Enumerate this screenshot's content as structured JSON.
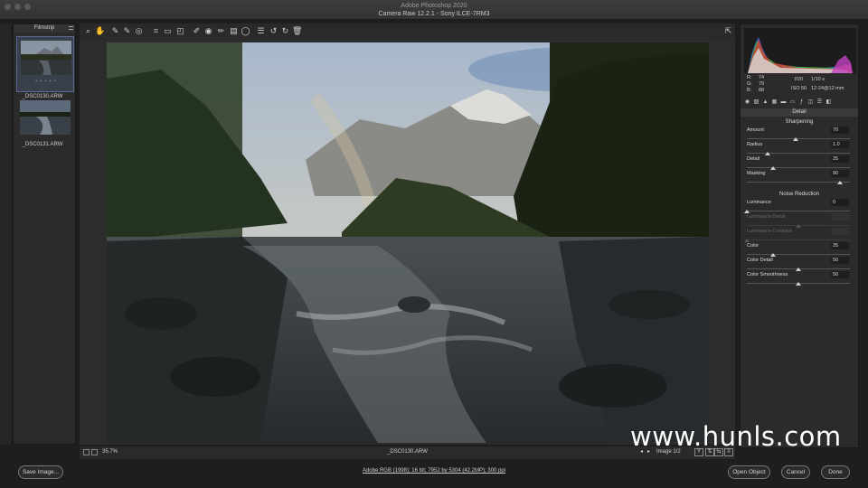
{
  "window": {
    "app_title": "Adobe Photoshop 2020",
    "subtitle": "Camera Raw 12.2.1  -  Sony ILCE-7RM3"
  },
  "filmstrip": {
    "title": "Filmstrip",
    "items": [
      {
        "label": "_DSC0130.ARW",
        "stars": "• • • • •",
        "selected": true
      },
      {
        "label": "_DSC0131.ARW",
        "stars": "",
        "selected": false
      }
    ]
  },
  "toolbar": {
    "tools": [
      "zoom-icon",
      "hand-icon",
      "white-balance-icon",
      "color-sampler-icon",
      "targeted-adjustment-icon",
      "crop-icon",
      "straighten-icon",
      "transform-icon",
      "spot-removal-icon",
      "red-eye-icon",
      "adjustment-brush-icon",
      "graduated-filter-icon",
      "radial-filter-icon",
      "preferences-icon",
      "rotate-left-icon",
      "rotate-right-icon",
      "trash-icon"
    ]
  },
  "status": {
    "zoom": "35.7%",
    "filename": "_DSC0130.ARW",
    "image_count": "Image 1/2"
  },
  "bottom": {
    "save_label": "Save Image...",
    "workflow": "Adobe RGB (1998); 16 bit; 7952 by 5304 (42.2MP); 300 ppi",
    "open_label": "Open Object",
    "cancel_label": "Cancel",
    "done_label": "Done"
  },
  "histogram": {
    "r_label": "R:",
    "r_value": "74",
    "g_label": "G:",
    "g_value": "79",
    "b_label": "B:",
    "b_value": "88",
    "aperture": "f/20",
    "shutter": "1/10 s",
    "iso": "ISO 50",
    "lens": "12-24@12 mm"
  },
  "detail_panel": {
    "title": "Detail",
    "sharpening_title": "Sharpening",
    "noise_title": "Noise Reduction",
    "sliders": [
      {
        "label": "Amount",
        "value": "70",
        "frac": 0.47,
        "enabled": true
      },
      {
        "label": "Radius",
        "value": "1.0",
        "frac": 0.2,
        "enabled": true
      },
      {
        "label": "Detail",
        "value": "25",
        "frac": 0.25,
        "enabled": true
      },
      {
        "label": "Masking",
        "value": "90",
        "frac": 0.9,
        "enabled": true
      },
      {
        "label": "Luminance",
        "value": "0",
        "frac": 0.0,
        "enabled": true
      },
      {
        "label": "Luminance Detail",
        "value": "",
        "frac": 0.5,
        "enabled": false
      },
      {
        "label": "Luminance Contrast",
        "value": "",
        "frac": 0.0,
        "enabled": false
      },
      {
        "label": "Color",
        "value": "25",
        "frac": 0.25,
        "enabled": true
      },
      {
        "label": "Color Detail",
        "value": "50",
        "frac": 0.5,
        "enabled": true
      },
      {
        "label": "Color Smoothness",
        "value": "50",
        "frac": 0.5,
        "enabled": true
      }
    ]
  },
  "watermark": "www.hunls.com"
}
